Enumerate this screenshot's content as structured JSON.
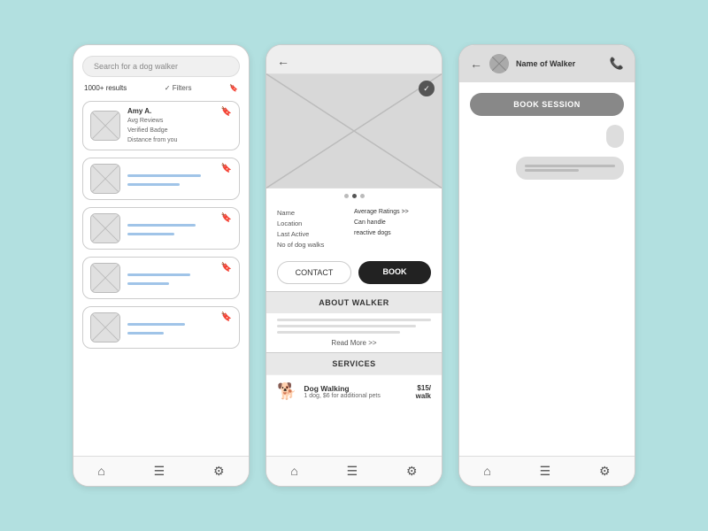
{
  "phone1": {
    "search_placeholder": "Search for a dog walker",
    "results_count": "1000+ results",
    "filters_label": "✓ Filters",
    "bookmark_icon": "🔖",
    "walkers": [
      {
        "name": "Amy A.",
        "line1": "Avg Reviews",
        "line2": "Verified Badge",
        "line3": "Distance from you"
      },
      {
        "name": "",
        "line1": "",
        "line2": ""
      },
      {
        "name": "",
        "line1": "",
        "line2": ""
      },
      {
        "name": "",
        "line1": "",
        "line2": ""
      },
      {
        "name": "",
        "line1": "",
        "line2": ""
      }
    ],
    "nav": {
      "home": "⌂",
      "list": "☰",
      "settings": "⚙"
    }
  },
  "phone2": {
    "back_arrow": "←",
    "dots": [
      1,
      2,
      3
    ],
    "profile_fields": {
      "name_label": "Name",
      "location_label": "Location",
      "last_active_label": "Last Active",
      "no_walks_label": "No of dog walks",
      "avg_ratings_label": "Average Ratings >>",
      "can_handle_label": "Can handle",
      "reactive_label": "reactive dogs"
    },
    "contact_button": "CONTACT",
    "book_button": "BOOK",
    "about_section": "ABOUT WALKER",
    "read_more": "Read More >>",
    "services_section": "SERVICES",
    "service": {
      "icon": "🐕",
      "name": "Dog Walking",
      "desc": "1 dog, $6 for additional pets",
      "price": "$15/",
      "price2": "walk"
    },
    "nav": {
      "home": "⌂",
      "list": "☰",
      "settings": "⚙"
    }
  },
  "phone3": {
    "back_arrow": "←",
    "walker_name": "Name of Walker",
    "phone_icon": "📞",
    "book_session_label": "BOOK SESSION",
    "nav": {
      "home": "⌂",
      "list": "☰",
      "settings": "⚙"
    }
  }
}
